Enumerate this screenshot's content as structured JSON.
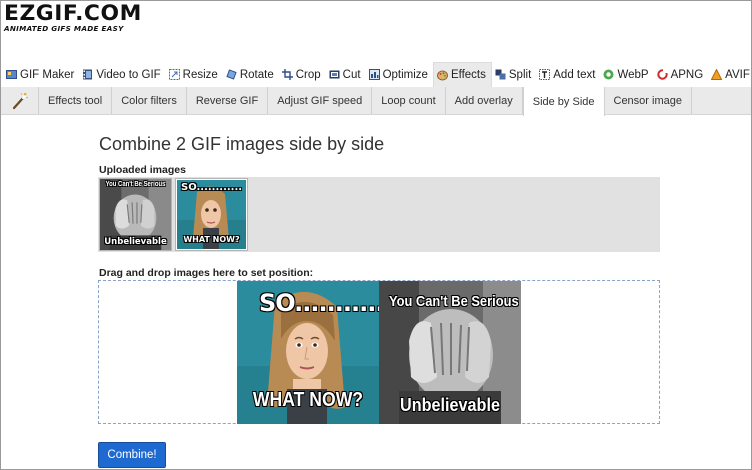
{
  "brand": {
    "name": "EZGIF.COM",
    "tagline": "ANIMATED GIFS MADE EASY"
  },
  "main_nav": [
    {
      "label": "GIF Maker",
      "icon": "gif-maker-icon"
    },
    {
      "label": "Video to GIF",
      "icon": "video-icon"
    },
    {
      "label": "Resize",
      "icon": "resize-icon"
    },
    {
      "label": "Rotate",
      "icon": "rotate-icon"
    },
    {
      "label": "Crop",
      "icon": "crop-icon"
    },
    {
      "label": "Cut",
      "icon": "cut-icon"
    },
    {
      "label": "Optimize",
      "icon": "optimize-icon"
    },
    {
      "label": "Effects",
      "icon": "palette-icon",
      "active": true
    },
    {
      "label": "Split",
      "icon": "split-icon"
    },
    {
      "label": "Add text",
      "icon": "add-text-icon"
    },
    {
      "label": "WebP",
      "icon": "webp-icon"
    },
    {
      "label": "APNG",
      "icon": "apng-icon"
    },
    {
      "label": "AVIF",
      "icon": "avif-icon"
    }
  ],
  "sub_nav": [
    {
      "label": "Effects tool"
    },
    {
      "label": "Color filters"
    },
    {
      "label": "Reverse GIF"
    },
    {
      "label": "Adjust GIF speed"
    },
    {
      "label": "Loop count"
    },
    {
      "label": "Add overlay"
    },
    {
      "label": "Side by Side",
      "active": true
    },
    {
      "label": "Censor image"
    }
  ],
  "page": {
    "title": "Combine 2 GIF images side by side",
    "uploaded_label": "Uploaded images",
    "drop_label": "Drag and drop images here to set position:",
    "combine_button": "Combine!"
  },
  "images": {
    "serious": {
      "top": "You Can't Be Serious",
      "bottom": "Unbelievable"
    },
    "so": {
      "top": "SO............",
      "bottom": "WHAT NOW?"
    }
  },
  "colors": {
    "button": "#1e6ad0",
    "teal_bg": "#2a8c9c",
    "dropzone_border": "#8aa3c8"
  }
}
